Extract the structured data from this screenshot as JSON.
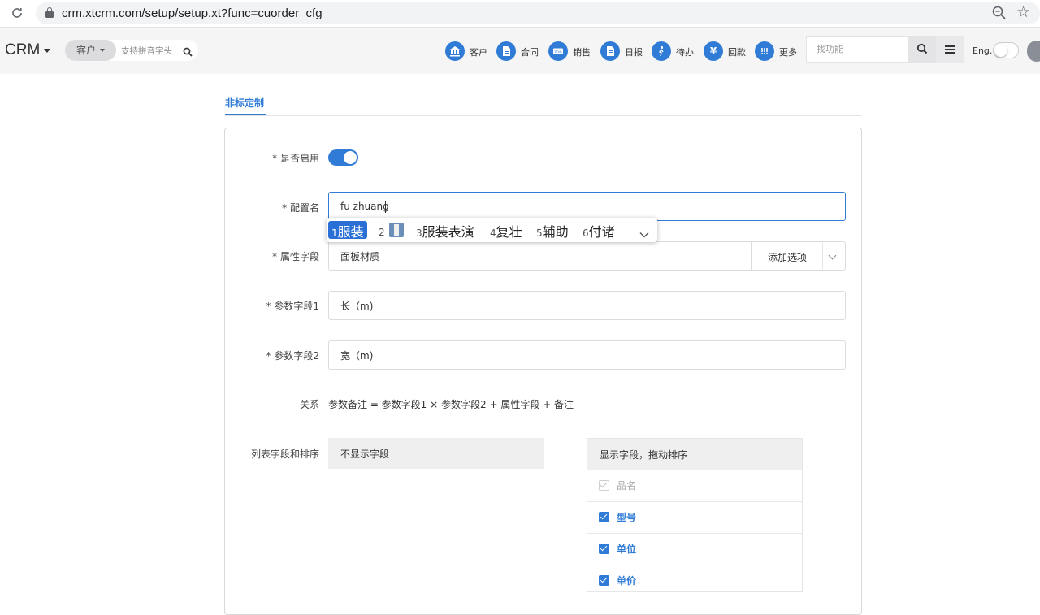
{
  "browser": {
    "url": "crm.xtcrm.com/setup/setup.xt?func=cuorder_cfg"
  },
  "header": {
    "brand": "CRM",
    "search_scope": "客户",
    "search_hint": "支持拼音字头",
    "nav": [
      {
        "label": "客户",
        "icon": "bank-icon",
        "glyph": "🏛"
      },
      {
        "label": "合同",
        "icon": "document-icon",
        "glyph": "▤"
      },
      {
        "label": "销售",
        "icon": "card-icon",
        "glyph": "▭"
      },
      {
        "label": "日报",
        "icon": "report-icon",
        "glyph": "▤"
      },
      {
        "label": "待办",
        "icon": "person-icon",
        "glyph": "✦"
      },
      {
        "label": "回款",
        "icon": "yen-icon",
        "glyph": "¥"
      },
      {
        "label": "更多",
        "icon": "grid-icon",
        "glyph": "⋮"
      }
    ],
    "func_search_placeholder": "找功能",
    "lang": "Eng."
  },
  "page": {
    "tab": "非标定制",
    "enable_label": "* 是否启用",
    "enabled": true,
    "name_label": "* 配置名",
    "name_value": "fu zhuang",
    "attr_label": "* 属性字段",
    "attr_value": "面板材质",
    "add_option": "添加选项",
    "param1_label": "* 参数字段1",
    "param1_value": "长（m)",
    "param2_label": "* 参数字段2",
    "param2_value": "宽（m)",
    "relation_label": "关系",
    "relation_value": "参数备注 = 参数字段1 × 参数字段2 + 属性字段 + 备注",
    "list_label": "列表字段和排序",
    "hidden_title": "不显示字段",
    "shown_title": "显示字段，拖动排序",
    "shown_fields": [
      {
        "label": "品名",
        "checked": true,
        "disabled": true
      },
      {
        "label": "型号",
        "checked": true,
        "disabled": false
      },
      {
        "label": "单位",
        "checked": true,
        "disabled": false
      },
      {
        "label": "单价",
        "checked": true,
        "disabled": false
      }
    ]
  },
  "ime": {
    "candidates": [
      {
        "num": "1",
        "word": "服装"
      },
      {
        "num": "2",
        "word": "",
        "emoji": "suit-emoji"
      },
      {
        "num": "3",
        "word": "服装表演"
      },
      {
        "num": "4",
        "word": "复壮"
      },
      {
        "num": "5",
        "word": "辅助"
      },
      {
        "num": "6",
        "word": "付诸"
      }
    ],
    "selected_index": 0
  },
  "colors": {
    "accent": "#2f7bd6",
    "header_bg": "#f5f5f6"
  }
}
